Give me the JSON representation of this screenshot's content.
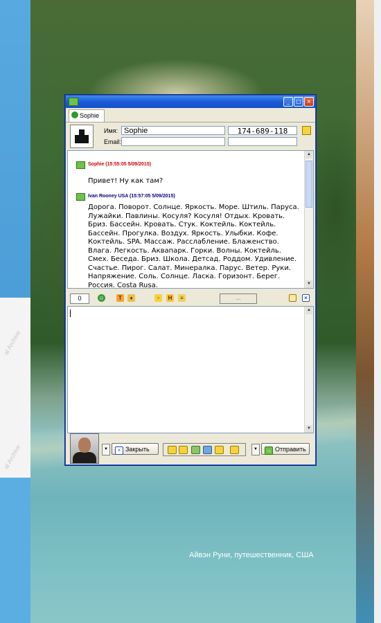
{
  "background": {
    "caption": "Айвэн Руни, путешественник, США",
    "watermark": "al Archive"
  },
  "window": {
    "tab_label": "Sophie",
    "contact": {
      "name_label": "Имя:",
      "name_value": "Sophie",
      "email_label": "Email:",
      "email_value": "",
      "phone": "174-689-118"
    },
    "messages": [
      {
        "header": "Sophie (15:55:05 5/09/2015)",
        "color": "#cc0000",
        "text": "Привет! Ну как там?"
      },
      {
        "header": "Ivan Rooney USA (15:57:05 5/09/2015)",
        "color": "#00007f",
        "text": "Дорога. Поворот. Солнце. Яркость. Море. Штиль. Паруса. Лужайки. Павлины. Косуля? Косуля! Отдых. Кровать. Бриз. Бассейн. Кровать. Стук. Коктейль. Коктейль. Бассейн. Прогулка. Воздух. Яркость. Улыбки. Кофе. Коктейль. SPA. Массаж. Расслабление. Блаженство. Влага. Легкость. Аквапарк. Горки. Волны. Коктейль. Смех. Беседа. Бриз. Школа. Детсад. Роддом. Удивление. Счастье. Пирог. Салат. Минералка. Парус. Ветер. Руки. Напряжение. Соль. Солнце. Ласка. Горизонт. Берег. Россия. Costa Rusa."
      }
    ],
    "format_bar": {
      "counter": "0",
      "more": "..."
    },
    "input_text": "",
    "buttons": {
      "close": "Закрыть",
      "send": "Отправить"
    },
    "colors": {
      "titlebar": "#1c5ad8",
      "chrome": "#ece9d8",
      "accent_green": "#6fc14a"
    }
  }
}
